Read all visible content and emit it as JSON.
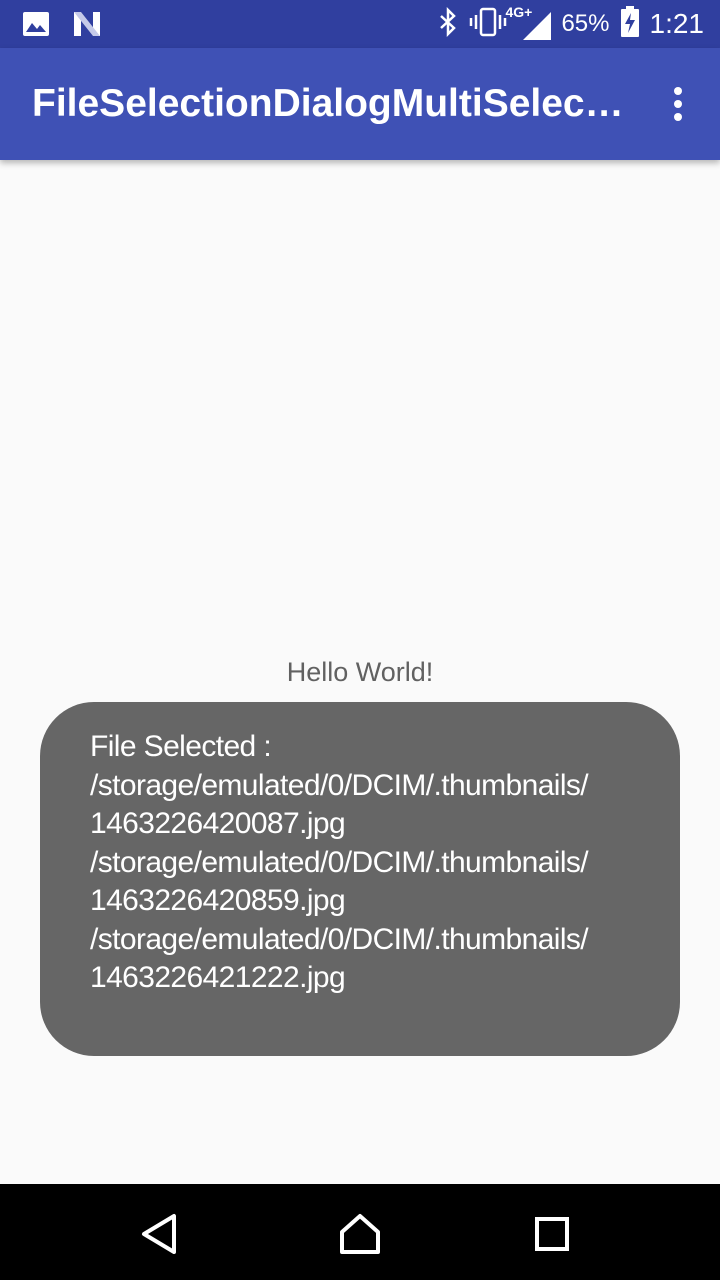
{
  "status_bar": {
    "network_type": "4G+",
    "battery_percent": "65%",
    "time": "1:21",
    "icons": [
      "image-icon",
      "n-icon",
      "bluetooth-icon",
      "vibrate-icon",
      "signal-icon",
      "battery-charging-icon"
    ]
  },
  "app_bar": {
    "title": "FileSelectionDialogMultiSelectT…",
    "menu_icon": "overflow-menu-icon"
  },
  "main": {
    "hello_text": "Hello World!"
  },
  "toast": {
    "lines": [
      "File Selected :",
      "/storage/emulated/0/DCIM/.thumbnails/",
      "1463226420087.jpg",
      "/storage/emulated/0/DCIM/.thumbnails/",
      "1463226420859.jpg",
      "/storage/emulated/0/DCIM/.thumbnails/",
      "1463226421222.jpg"
    ]
  },
  "nav_bar": {
    "icons": [
      "back-icon",
      "home-icon",
      "recents-icon"
    ]
  },
  "colors": {
    "status_bar": "#303f9f",
    "app_bar": "#3f51b5",
    "background": "#fafafa",
    "toast": "#666666"
  }
}
